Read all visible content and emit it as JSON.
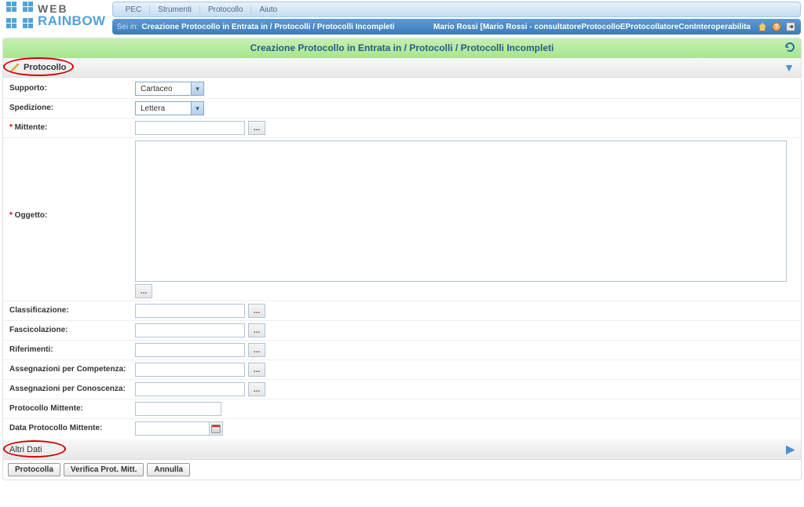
{
  "logo": {
    "line1": "WEB",
    "line2": "RAINBOW"
  },
  "menu": {
    "items": [
      "PEC",
      "Strumenti",
      "Protocollo",
      "Aiuto"
    ]
  },
  "breadcrumb": {
    "label": "Sei in:",
    "path": "Creazione Protocollo in Entrata in / Protocolli / Protocolli Incompleti",
    "user": "Mario Rossi [Mario Rossi - consultatoreProtocolloEProtocollatoreConInteroperabilita"
  },
  "title": "Creazione Protocollo in Entrata in / Protocolli / Protocolli Incompleti",
  "sections": {
    "protocollo": {
      "label": "Protocollo"
    },
    "altri_dati": {
      "label": "Altri Dati"
    }
  },
  "form": {
    "supporto": {
      "label": "Supporto:",
      "value": "Cartaceo"
    },
    "spedizione": {
      "label": "Spedizione:",
      "value": "Lettera"
    },
    "mittente": {
      "label": "Mittente:",
      "required": true,
      "value": ""
    },
    "oggetto": {
      "label": "Oggetto:",
      "required": true,
      "value": ""
    },
    "classificazione": {
      "label": "Classificazione:",
      "value": ""
    },
    "fascicolazione": {
      "label": "Fascicolazione:",
      "value": ""
    },
    "riferimenti": {
      "label": "Riferimenti:",
      "value": ""
    },
    "assegn_competenza": {
      "label": "Assegnazioni per Competenza:",
      "value": ""
    },
    "assegn_conoscenza": {
      "label": "Assegnazioni per Conoscenza:",
      "value": ""
    },
    "protocollo_mittente": {
      "label": "Protocollo Mittente:",
      "value": ""
    },
    "data_protocollo_mittente": {
      "label": "Data Protocollo Mittente:",
      "value": ""
    }
  },
  "lookup_label": "...",
  "buttons": {
    "protocolla": "Protocolla",
    "verifica": "Verifica Prot. Mitt.",
    "annulla": "Annulla"
  }
}
